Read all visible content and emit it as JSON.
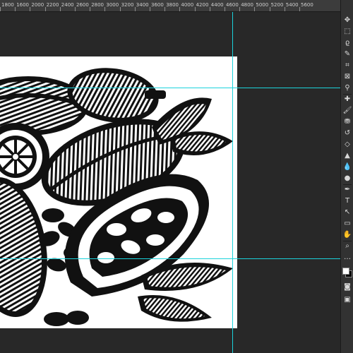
{
  "ruler": {
    "labels": [
      "1800",
      "1600",
      "2000",
      "2200",
      "2400",
      "2600",
      "2800",
      "3000",
      "3200",
      "3400",
      "3600",
      "3800",
      "4000",
      "4200",
      "4400",
      "4600",
      "4800",
      "5000",
      "5200",
      "5400",
      "5600"
    ]
  },
  "artwork": {
    "subject": "cacao pods woodcut illustration"
  },
  "toolbar": {
    "tools": [
      {
        "name": "move-tool-icon",
        "glyph": "✥"
      },
      {
        "name": "marquee-tool-icon",
        "glyph": "⬚"
      },
      {
        "name": "lasso-tool-icon",
        "glyph": "ϱ"
      },
      {
        "name": "quick-selection-tool-icon",
        "glyph": "✎"
      },
      {
        "name": "crop-tool-icon",
        "glyph": "⌗"
      },
      {
        "name": "frame-tool-icon",
        "glyph": "⊠"
      },
      {
        "name": "eyedropper-tool-icon",
        "glyph": "⚲"
      },
      {
        "name": "spot-healing-tool-icon",
        "glyph": "✚"
      },
      {
        "name": "brush-tool-icon",
        "glyph": "🖌"
      },
      {
        "name": "clone-stamp-tool-icon",
        "glyph": "⛃"
      },
      {
        "name": "history-brush-tool-icon",
        "glyph": "↺"
      },
      {
        "name": "eraser-tool-icon",
        "glyph": "◇"
      },
      {
        "name": "paint-bucket-tool-icon",
        "glyph": "▲"
      },
      {
        "name": "blur-tool-icon",
        "glyph": "💧"
      },
      {
        "name": "dodge-tool-icon",
        "glyph": "●"
      },
      {
        "name": "pen-tool-icon",
        "glyph": "✒"
      },
      {
        "name": "type-tool-icon",
        "glyph": "T"
      },
      {
        "name": "path-selection-tool-icon",
        "glyph": "↖"
      },
      {
        "name": "rectangle-tool-icon",
        "glyph": "▭"
      },
      {
        "name": "hand-tool-icon",
        "glyph": "✋"
      },
      {
        "name": "zoom-tool-icon",
        "glyph": "⌕"
      },
      {
        "name": "more-tools-icon",
        "glyph": "…"
      }
    ],
    "swatches": {
      "foreground": "#ffffff",
      "background": "#000000"
    },
    "mode_icons": [
      {
        "name": "quick-mask-icon",
        "glyph": "◙"
      },
      {
        "name": "screen-mode-icon",
        "glyph": "▣"
      }
    ]
  },
  "colors": {
    "guide": "#1bd3dc",
    "workspace": "#282828",
    "ink": "#111111",
    "paper": "#ffffff"
  }
}
